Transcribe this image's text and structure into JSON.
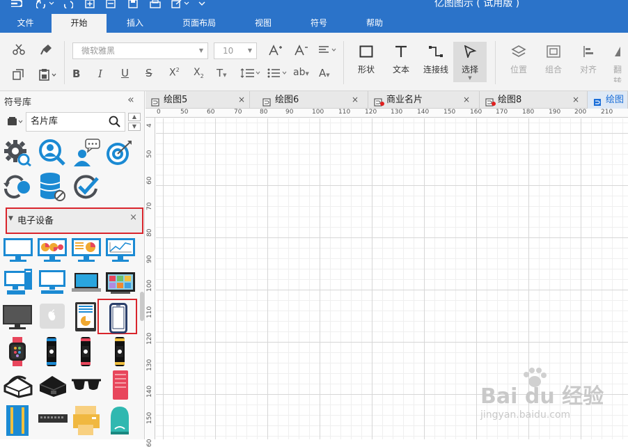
{
  "app": {
    "title": "亿图图示 ( 试用版 )"
  },
  "menu": {
    "tabs": [
      {
        "label": "文件"
      },
      {
        "label": "开始"
      },
      {
        "label": "插入"
      },
      {
        "label": "页面布局"
      },
      {
        "label": "视图"
      },
      {
        "label": "符号"
      },
      {
        "label": "帮助"
      }
    ],
    "active": "开始"
  },
  "ribbon": {
    "font_name": "微软雅黑",
    "font_size": "10",
    "tools": {
      "shape": "形状",
      "text": "文本",
      "connector": "连接线",
      "select": "选择",
      "position": "位置",
      "group": "组合",
      "align": "对齐",
      "flip": "翻转"
    }
  },
  "library": {
    "title": "符号库",
    "search_value": "名片库",
    "category": "电子设备"
  },
  "tabs": [
    {
      "label": "绘图5",
      "unsaved": false
    },
    {
      "label": "绘图6",
      "unsaved": false
    },
    {
      "label": "商业名片",
      "unsaved": true
    },
    {
      "label": "绘图8",
      "unsaved": true
    },
    {
      "label": "绘图",
      "unsaved": false
    }
  ],
  "ruler": {
    "top": [
      "0",
      "50",
      "60",
      "70",
      "80",
      "90",
      "100",
      "110",
      "120",
      "130",
      "140",
      "150",
      "160",
      "170",
      "180",
      "190",
      "200",
      "210"
    ],
    "left": [
      "4",
      "50",
      "60",
      "70",
      "80",
      "90",
      "100",
      "110",
      "120",
      "130",
      "140",
      "150",
      "60"
    ]
  },
  "watermark": {
    "logo": "Bai du 经验",
    "url": "jingyan.baidu.com"
  },
  "colors": {
    "brand": "#2b73c9",
    "highlight": "#d9252c",
    "icon_blue": "#1b8ad3"
  }
}
